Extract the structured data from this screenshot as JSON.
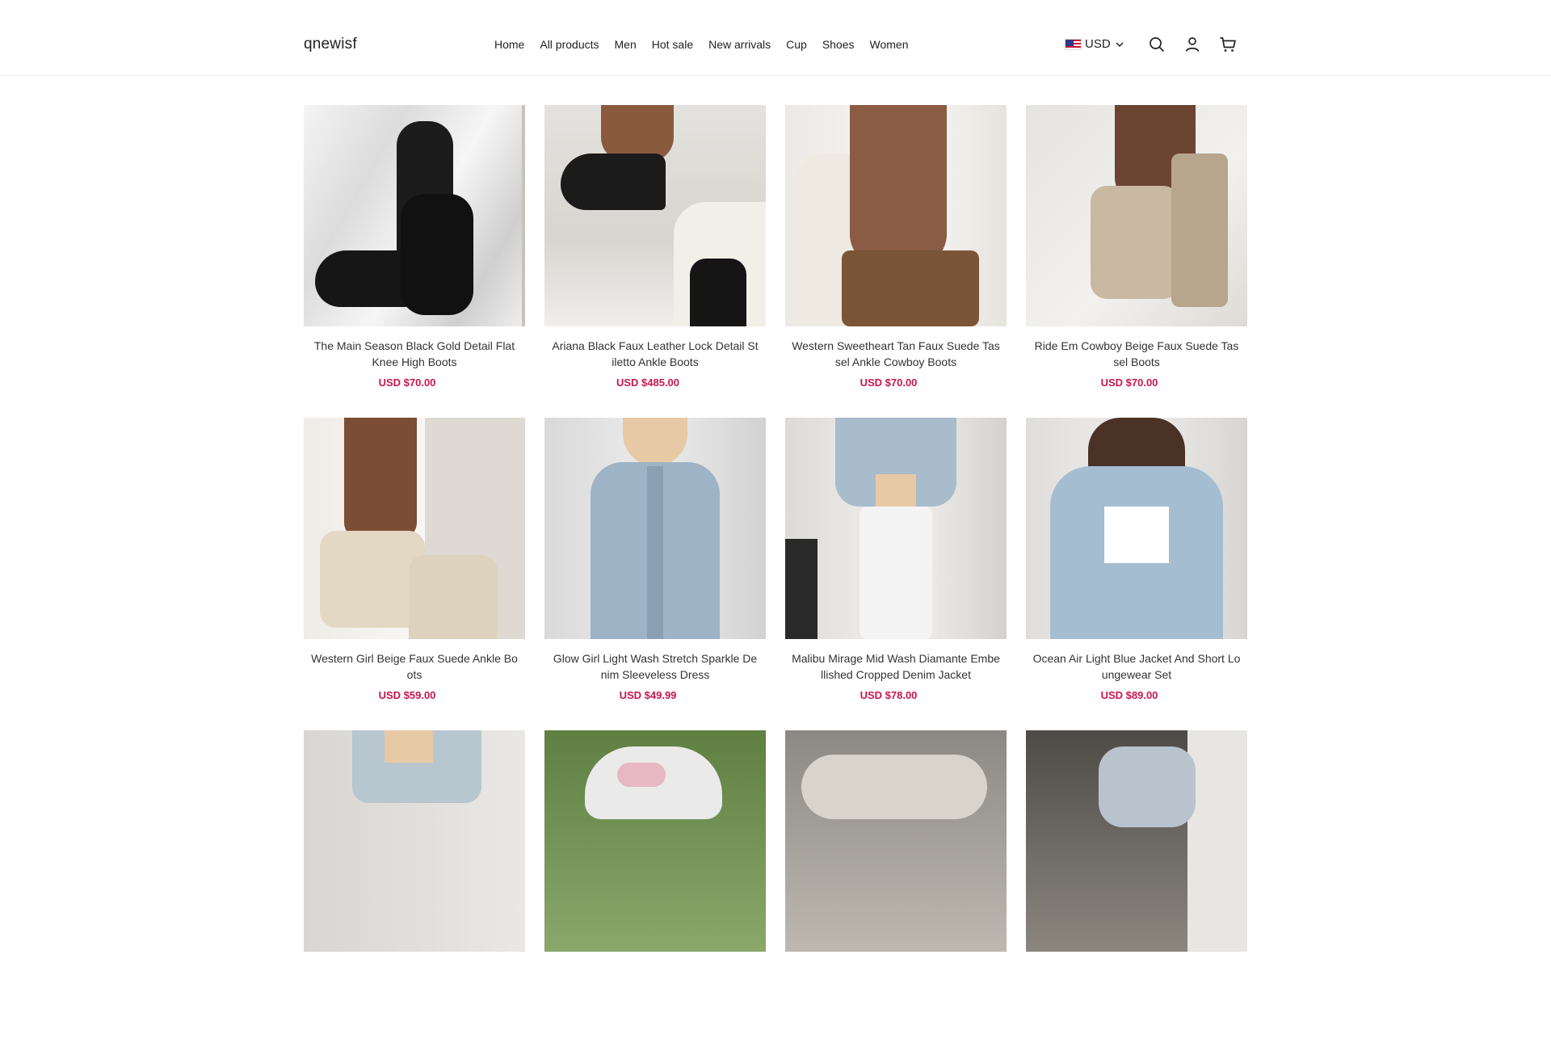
{
  "brand": {
    "name": "qnewisf"
  },
  "nav": {
    "items": [
      {
        "label": "Home"
      },
      {
        "label": "All products"
      },
      {
        "label": "Men"
      },
      {
        "label": "Hot sale"
      },
      {
        "label": "New arrivals"
      },
      {
        "label": "Cup"
      },
      {
        "label": "Shoes"
      },
      {
        "label": "Women"
      }
    ]
  },
  "currency": {
    "label": "USD",
    "flag": "us-flag-icon"
  },
  "header_icons": [
    "search-icon",
    "account-icon",
    "cart-icon"
  ],
  "colors": {
    "price": "#c8174e",
    "text": "#333333",
    "border": "#ececec"
  },
  "products": [
    {
      "title": "The Main Season Black Gold Detail Flat Knee High Boots",
      "price": "USD $70.00"
    },
    {
      "title": "Ariana Black Faux Leather Lock Detail Stiletto Ankle Boots",
      "price": "USD $485.00"
    },
    {
      "title": "Western Sweetheart Tan Faux Suede Tassel Ankle Cowboy Boots",
      "price": "USD $70.00"
    },
    {
      "title": "Ride Em Cowboy Beige Faux Suede Tassel Boots",
      "price": "USD $70.00"
    },
    {
      "title": "Western Girl Beige Faux Suede Ankle Boots",
      "price": "USD $59.00"
    },
    {
      "title": "Glow Girl Light Wash Stretch Sparkle Denim Sleeveless Dress",
      "price": "USD $49.99"
    },
    {
      "title": "Malibu Mirage Mid Wash Diamante Embellished Cropped Denim Jacket",
      "price": "USD $78.00"
    },
    {
      "title": "Ocean Air Light Blue Jacket And Short Loungewear Set",
      "price": "USD $89.00"
    },
    {
      "title": "",
      "price": ""
    },
    {
      "title": "",
      "price": ""
    },
    {
      "title": "",
      "price": ""
    },
    {
      "title": "",
      "price": ""
    }
  ]
}
